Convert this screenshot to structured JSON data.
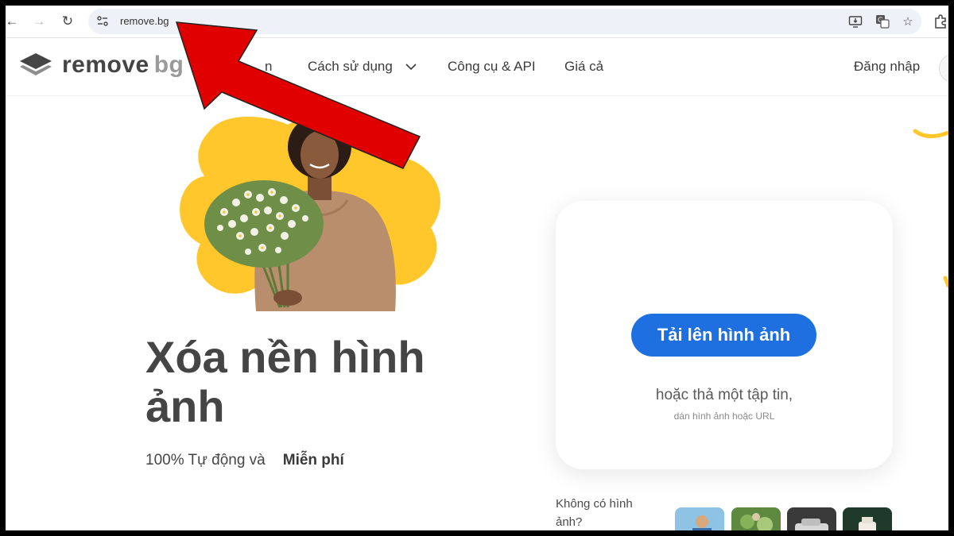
{
  "browser": {
    "url": "remove.bg",
    "icons": {
      "back": "back-arrow-icon",
      "forward": "forward-arrow-icon",
      "reload": "reload-icon",
      "site_info": "site-info-icon",
      "install": "install-app-icon",
      "translate": "translate-icon",
      "bookmark": "star-icon",
      "extensions": "puzzle-icon"
    }
  },
  "header": {
    "logo_part1": "remove",
    "logo_part2": "bg",
    "nav": {
      "partial": "n",
      "how_to_use": "Cách sử dụng",
      "tools_api": "Công cụ & API",
      "pricing": "Giá cả"
    },
    "login": "Đăng nhập"
  },
  "hero": {
    "headline": "Xóa nền hình ảnh",
    "sub_prefix": "100% Tự động và",
    "sub_highlight": "Miễn phí"
  },
  "upload": {
    "button": "Tải lên hình ảnh",
    "drop_text": "hoặc thả một tập tin,",
    "paste_text": "dán hình ảnh hoặc URL"
  },
  "samples": {
    "label": "Không có hình ảnh?"
  },
  "colors": {
    "accent_blue": "#1e6fe0",
    "highlight_yellow": "#ffcb3c",
    "annotation_red": "#e00000"
  }
}
